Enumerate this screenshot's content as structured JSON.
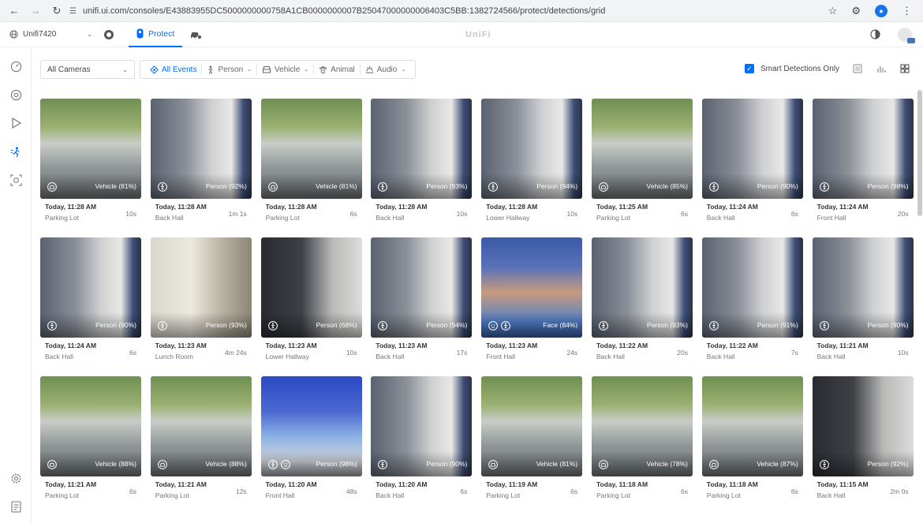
{
  "browser": {
    "url": "unifi.ui.com/consoles/E43883955DC5000000000758A1CB0000000007B25047000000006403C5BB:1382724566/protect/detections/grid"
  },
  "header": {
    "console_name": "Unifi7420",
    "protect_label": "Protect",
    "app_title": "UniFi"
  },
  "filters": {
    "camera_select": "All Cameras",
    "all_events": "All Events",
    "person": "Person",
    "vehicle": "Vehicle",
    "animal": "Animal",
    "audio": "Audio",
    "smart_detections_label": "Smart Detections Only"
  },
  "colors": {
    "accent": "#006fff"
  },
  "events": [
    {
      "label": "Vehicle (81%)",
      "time": "Today, 11:28 AM",
      "camera": "Parking Lot",
      "duration": "10s",
      "icons": [
        "car-icon"
      ],
      "scene": "lot"
    },
    {
      "label": "Person (92%)",
      "time": "Today, 11:28 AM",
      "camera": "Back Hall",
      "duration": "1m 1s",
      "icons": [
        "person-icon"
      ],
      "scene": "hall"
    },
    {
      "label": "Vehicle (81%)",
      "time": "Today, 11:28 AM",
      "camera": "Parking Lot",
      "duration": "6s",
      "icons": [
        "car-icon"
      ],
      "scene": "lot"
    },
    {
      "label": "Person (93%)",
      "time": "Today, 11:28 AM",
      "camera": "Back Hall",
      "duration": "10s",
      "icons": [
        "person-icon"
      ],
      "scene": "hall"
    },
    {
      "label": "Person (94%)",
      "time": "Today, 11:28 AM",
      "camera": "Lower Hallway",
      "duration": "10s",
      "icons": [
        "person-icon"
      ],
      "scene": "hall"
    },
    {
      "label": "Vehicle (85%)",
      "time": "Today, 11:25 AM",
      "camera": "Parking Lot",
      "duration": "6s",
      "icons": [
        "car-icon"
      ],
      "scene": "lot"
    },
    {
      "label": "Person (90%)",
      "time": "Today, 11:24 AM",
      "camera": "Back Hall",
      "duration": "6s",
      "icons": [
        "person-icon"
      ],
      "scene": "hall"
    },
    {
      "label": "Person (98%)",
      "time": "Today, 11:24 AM",
      "camera": "Front Hall",
      "duration": "20s",
      "icons": [
        "person-icon"
      ],
      "scene": "hall"
    },
    {
      "label": "Person (90%)",
      "time": "Today, 11:24 AM",
      "camera": "Back Hall",
      "duration": "6s",
      "icons": [
        "person-icon"
      ],
      "scene": "hall"
    },
    {
      "label": "Person (93%)",
      "time": "Today, 11:23 AM",
      "camera": "Lunch Room",
      "duration": "4m 24s",
      "icons": [
        "person-icon"
      ],
      "scene": "room"
    },
    {
      "label": "Person (68%)",
      "time": "Today, 11:23 AM",
      "camera": "Lower Hallway",
      "duration": "10s",
      "icons": [
        "person-icon"
      ],
      "scene": "dark"
    },
    {
      "label": "Person (94%)",
      "time": "Today, 11:23 AM",
      "camera": "Back Hall",
      "duration": "17s",
      "icons": [
        "person-icon"
      ],
      "scene": "hall"
    },
    {
      "label": "Face (84%)",
      "time": "Today, 11:23 AM",
      "camera": "Front Hall",
      "duration": "24s",
      "icons": [
        "face-icon",
        "person-icon"
      ],
      "scene": "face"
    },
    {
      "label": "Person (93%)",
      "time": "Today, 11:22 AM",
      "camera": "Back Hall",
      "duration": "20s",
      "icons": [
        "person-icon"
      ],
      "scene": "hall"
    },
    {
      "label": "Person (91%)",
      "time": "Today, 11:22 AM",
      "camera": "Back Hall",
      "duration": "7s",
      "icons": [
        "person-icon"
      ],
      "scene": "hall"
    },
    {
      "label": "Person (90%)",
      "time": "Today, 11:21 AM",
      "camera": "Back Hall",
      "duration": "10s",
      "icons": [
        "person-icon"
      ],
      "scene": "hall"
    },
    {
      "label": "Vehicle (88%)",
      "time": "Today, 11:21 AM",
      "camera": "Parking Lot",
      "duration": "6s",
      "icons": [
        "car-icon"
      ],
      "scene": "lot"
    },
    {
      "label": "Vehicle (88%)",
      "time": "Today, 11:21 AM",
      "camera": "Parking Lot",
      "duration": "12s",
      "icons": [
        "car-icon"
      ],
      "scene": "lot"
    },
    {
      "label": "Person (98%)",
      "time": "Today, 11:20 AM",
      "camera": "Front Hall",
      "duration": "48s",
      "icons": [
        "person-icon",
        "face-icon"
      ],
      "scene": "blue"
    },
    {
      "label": "Person (90%)",
      "time": "Today, 11:20 AM",
      "camera": "Back Hall",
      "duration": "6s",
      "icons": [
        "person-icon"
      ],
      "scene": "hall"
    },
    {
      "label": "Vehicle (81%)",
      "time": "Today, 11:19 AM",
      "camera": "Parking Lot",
      "duration": "6s",
      "icons": [
        "car-icon"
      ],
      "scene": "lot"
    },
    {
      "label": "Vehicle (78%)",
      "time": "Today, 11:18 AM",
      "camera": "Parking Lot",
      "duration": "6s",
      "icons": [
        "car-icon"
      ],
      "scene": "lot"
    },
    {
      "label": "Vehicle (87%)",
      "time": "Today, 11:18 AM",
      "camera": "Parking Lot",
      "duration": "6s",
      "icons": [
        "car-icon"
      ],
      "scene": "lot"
    },
    {
      "label": "Person (92%)",
      "time": "Today, 11:15 AM",
      "camera": "Back Hall",
      "duration": "2m 0s",
      "icons": [
        "person-icon"
      ],
      "scene": "dark"
    }
  ]
}
